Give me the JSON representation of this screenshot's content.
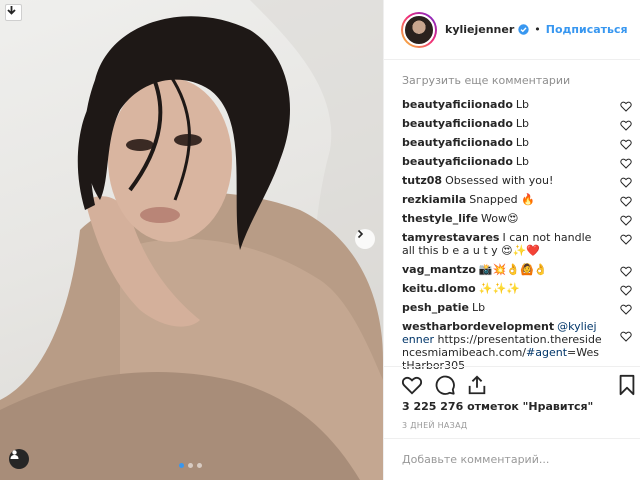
{
  "header": {
    "username": "kyliejenner",
    "bullet": "•",
    "follow_label": "Подписаться"
  },
  "comments": {
    "load_more": "Загрузить еще комментарии",
    "items": [
      {
        "user": "beautyaficiionado",
        "text": "Lb"
      },
      {
        "user": "beautyaficiionado",
        "text": "Lb"
      },
      {
        "user": "beautyaficiionado",
        "text": "Lb"
      },
      {
        "user": "beautyaficiionado",
        "text": "Lb"
      },
      {
        "user": "tutz08",
        "text": "Obsessed with you!"
      },
      {
        "user": "rezkiamila",
        "text": "Snapped 🔥"
      },
      {
        "user": "thestyle_life",
        "text": "Wow😍"
      },
      {
        "user": "tamyrestavares",
        "text": "I can not handle all this b e a u t y 😍✨❤️"
      },
      {
        "user": "vag_mantzo",
        "text": "📸💥👌🙆👌"
      },
      {
        "user": "keitu.dlomo",
        "text": "✨✨✨"
      },
      {
        "user": "pesh_patie",
        "text": "Lb"
      },
      {
        "user": "westharbordevelopment",
        "mention": "@kyliejenner",
        "text": "https://presentation.theresidencesmiamibeach.com/",
        "hashtag": "#agent",
        "tail": "=WestHarbor305"
      }
    ]
  },
  "post": {
    "likes": "3 225 276 отметок \"Нравится\"",
    "time": "3 ДНЕЙ НАЗАД",
    "comment_placeholder": "Добавьте комментарий..."
  },
  "icons": {
    "download": "download-icon",
    "next": "chevron-right-icon",
    "user_tag": "user-icon",
    "verified": "verified-badge-icon",
    "heart": "heart-outline-icon",
    "comment": "comment-icon",
    "share": "share-icon",
    "save": "bookmark-icon"
  },
  "colors": {
    "accent": "#3897f0",
    "link": "#003569",
    "muted": "#8e8e8e"
  }
}
